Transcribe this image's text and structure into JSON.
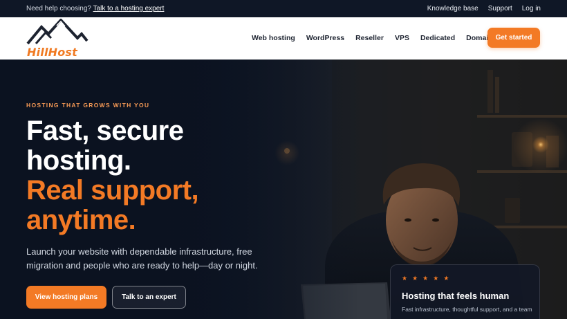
{
  "topbar": {
    "help_prefix": "Need help choosing?",
    "help_link": "Talk to a hosting expert",
    "links": [
      "Knowledge base",
      "Support",
      "Log in"
    ]
  },
  "brand": {
    "name": "HillHost",
    "accent": "#f37a25"
  },
  "nav": {
    "items": [
      "Web hosting",
      "WordPress",
      "Reseller",
      "VPS",
      "Dedicated",
      "Domains"
    ],
    "cta": "Get started"
  },
  "hero": {
    "eyebrow": "HOSTING THAT GROWS WITH YOU",
    "headline_white_1": "Fast, secure",
    "headline_white_2": "hosting.",
    "headline_orange_1": "Real support,",
    "headline_orange_2": "anytime.",
    "subtitle": "Launch your website with dependable infrastructure, free migration and people who are ready to help—day or night.",
    "primary_button": "View hosting plans",
    "secondary_button": "Talk to an expert"
  },
  "card": {
    "rating": 5,
    "stars": [
      "★",
      "★",
      "★",
      "★",
      "★"
    ],
    "title": "Hosting that feels human",
    "text": "Fast infrastructure, thoughtful support, and a team"
  }
}
